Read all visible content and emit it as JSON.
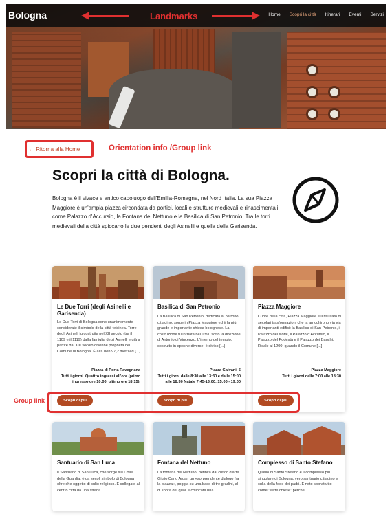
{
  "header": {
    "brand": "Bologna",
    "nav": [
      {
        "label": "Home",
        "active": false
      },
      {
        "label": "Scopri la città",
        "active": true
      },
      {
        "label": "Itinerari",
        "active": false
      },
      {
        "label": "Eventi",
        "active": false
      },
      {
        "label": "Servizi",
        "active": false
      }
    ]
  },
  "annotations": {
    "landmarks": "Landmarks",
    "orientation": "Orientation info /Group link",
    "group_link": "Group link",
    "color": "#e03030"
  },
  "back_link": "← Ritorna alla Home",
  "intro": {
    "title": "Scopri la città di Bologna.",
    "text": "Bologna è il vivace e antico capoluogo dell'Emilia-Romagna, nel Nord Italia. La sua Piazza Maggiore è un'ampia piazza circondata da portici, locali e strutture medievali e rinascimentali come Palazzo d'Accursio, la Fontana del Nettuno e la Basilica di San Petronio. Tra le torri medievali della città spiccano le due pendenti degli Asinelli e quella della Garisenda.",
    "icon": "compass-icon"
  },
  "button_label": "Scopri di più",
  "accent_color": "#b24a22",
  "cards": [
    {
      "title": "Le Due Torri (degli Asinelli e Garisenda)",
      "desc": "Le Due Torri di Bologna sono unanimemente considerate il simbolo della città felsinea. Torre degli Asinelli fu costruita nel XII secolo (tra il 1109 e il 1119) dalla famiglia degli Asinelli e già a partire dal XIII secolo divenne proprietà del Comune di Bologna. È alta ben 97,2 metri ed [...]",
      "address": "Piazza di Porta Ravegnana",
      "hours": "Tutti i giorni. Quattro ingressi all'ora (primo ingresso ore 10:00, ultimo ore 18:15)."
    },
    {
      "title": "Basilica di San Petronio",
      "desc": "La Basilica di San Petronio, dedicata al patrono cittadino, sorge in Piazza Maggiore ed è la più grande e importante chiesa bolognese. La costruzione fu iniziata nel 1390 sotto la direzione di Antonio di Vincenzo. L'interno del tempio, costruito in epoche diverse, è diviso [...]",
      "address": "Piazza Galvani, 5",
      "hours": "Tutti i giorni dalle 8:30 alle 13:30 e dalle 15:00 alle 18:30 Natale 7:45-13:00; 15:00 - 19:00"
    },
    {
      "title": "Piazza Maggiore",
      "desc": "Cuore della città, Piazza Maggiore è il risultato di secolari trasformazioni che la arricchirono via via di importanti edifici: la Basilica di San Petronio, il Palazzo dei Notai, il Palazzo d'Accursio, il Palazzo del Podestà e il Palazzo dei Banchi. Risale al 1200, quando il Comune [...]",
      "address": "Piazza Maggiore",
      "hours": "Tutti i giorni dalle 7:00 alle 18:30"
    },
    {
      "title": "Santuario di San Luca",
      "desc": "Il Santuario di San Luca, che sorge sul Colle della Guardia, è da secoli simbolo di Bologna oltre che oggetto di culto religioso. È collegato al centro città da una strada"
    },
    {
      "title": "Fontana del Nettuno",
      "desc": "La fontana del Nettuno, definita dal critico d'arte Giulio Carlo Argan un «sorprendente dialogo fra la piazza», poggia su una base di tre gradini, al di sopra dei quali è collocata una"
    },
    {
      "title": "Complesso di Santo Stefano",
      "desc": "Quello di Santo Stefano è il complesso più singolare di Bologna, vero santuario cittadino e culla della fede dei padri. È noto soprattutto come \"sette chiese\" perché"
    }
  ]
}
